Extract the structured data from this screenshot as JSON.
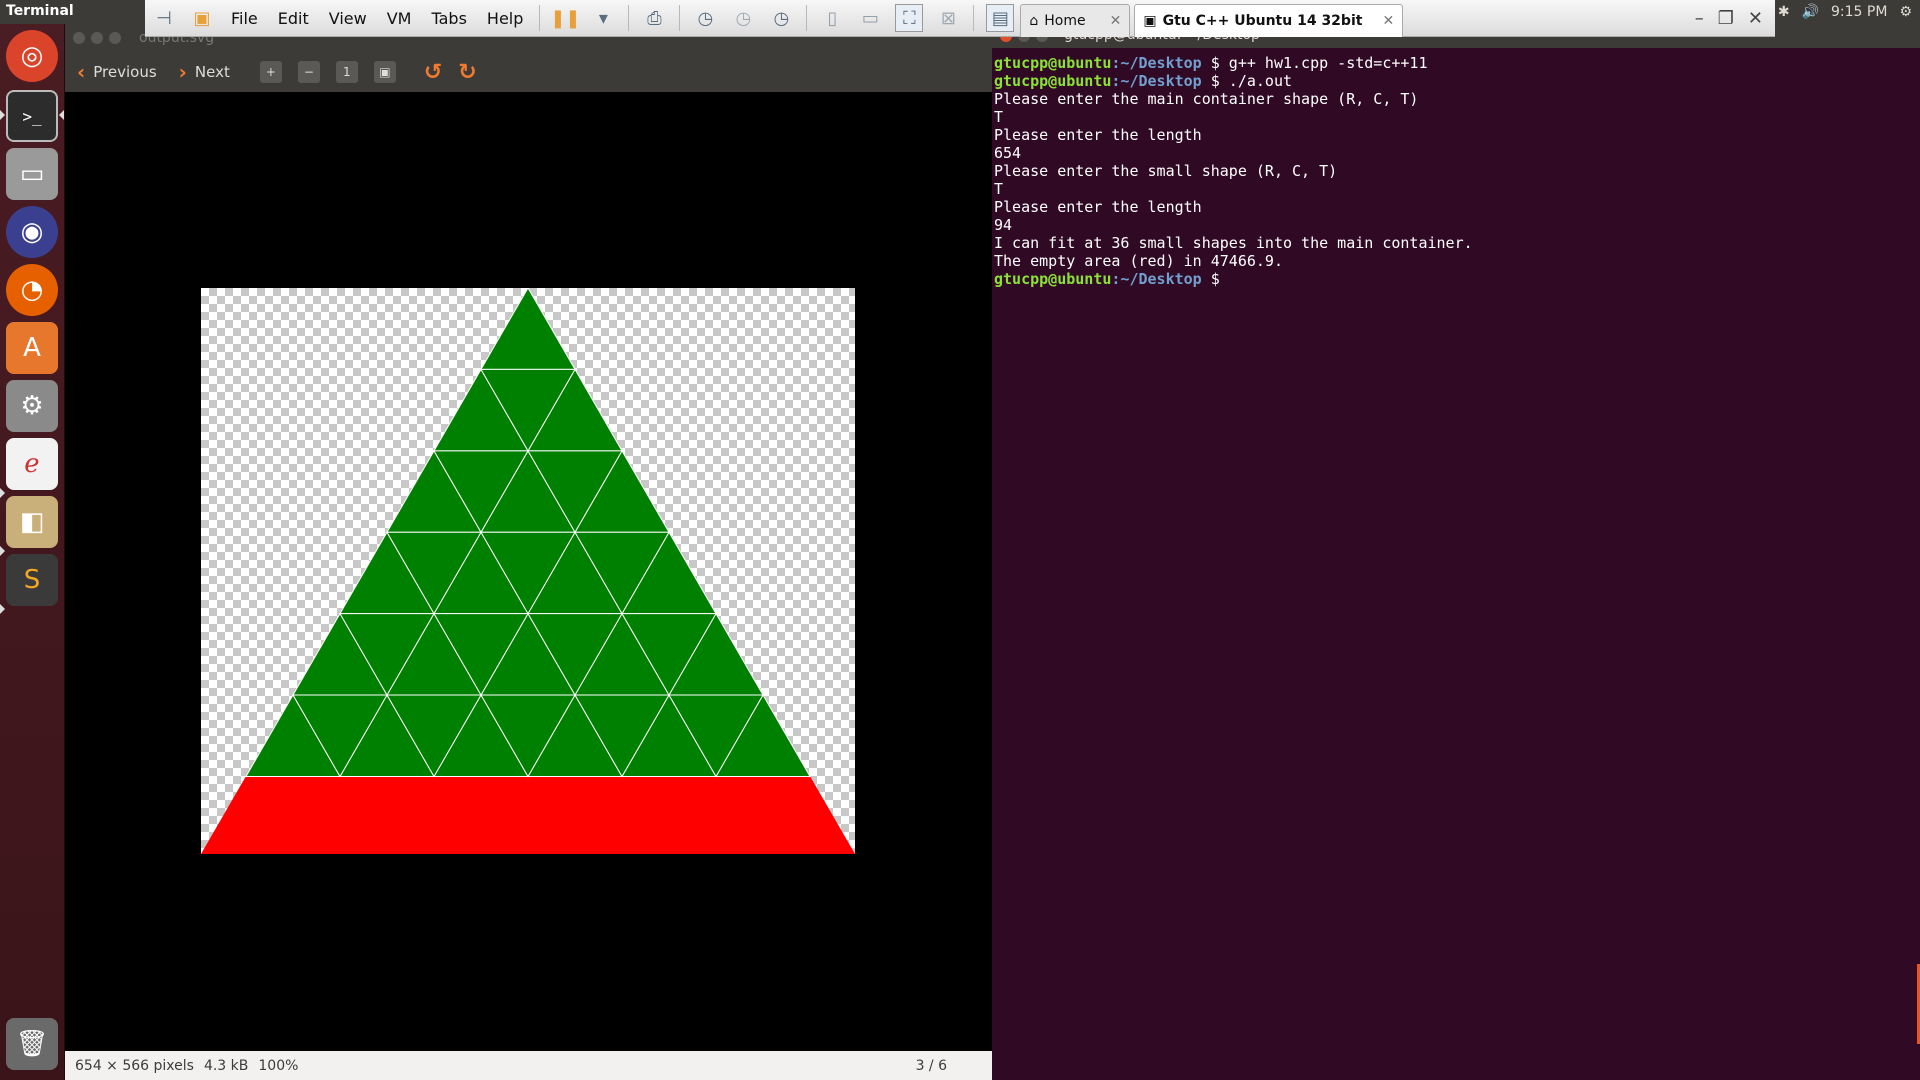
{
  "top_panel": {
    "app_title": "Terminal",
    "time": "9:15 PM"
  },
  "vm_toolbar": {
    "menus": [
      "File",
      "Edit",
      "View",
      "VM",
      "Tabs",
      "Help"
    ],
    "tabs": [
      {
        "label": "Home"
      },
      {
        "label": "Gtu C++ Ubuntu 14 32bit"
      }
    ]
  },
  "viewer": {
    "title": "output.svg",
    "prev_label": "Previous",
    "next_label": "Next",
    "status": {
      "dimensions": "654 × 566 pixels",
      "size": "4.3 kB",
      "zoom": "100%",
      "position": "3 / 6"
    },
    "colors": {
      "fill": "#008000",
      "empty": "#ff0000",
      "lines": "#ffffff"
    }
  },
  "terminal": {
    "title": "gtucpp@ubuntu: ~/Desktop",
    "prompt_user": "gtucpp@ubuntu",
    "prompt_path": ":~/Desktop",
    "cmd1": "$ g++ hw1.cpp -std=c++11",
    "cmd2": "$ ./a.out",
    "cmd3": "$",
    "output": [
      "Please enter the main container shape (R, C, T)",
      "T",
      "Please enter the length",
      "654",
      "Please enter the small shape (R, C, T)",
      "T",
      "Please enter the length",
      "94",
      "I can fit at 36 small shapes into the main container.",
      "The empty area (red) in 47466.9."
    ]
  }
}
